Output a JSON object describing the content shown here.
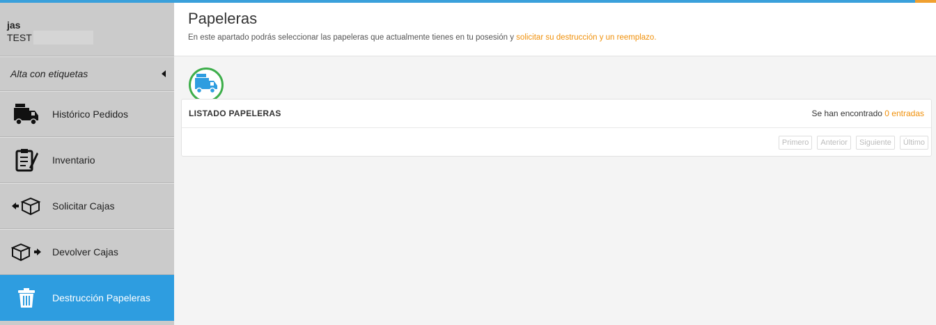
{
  "user": {
    "name": "jas",
    "company": "TEST"
  },
  "sidebar": {
    "alta_label": "Alta con etiquetas",
    "items": [
      {
        "label": "Histórico Pedidos",
        "icon": "delivery-truck-icon"
      },
      {
        "label": "Inventario",
        "icon": "clipboard-pen-icon"
      },
      {
        "label": "Solicitar Cajas",
        "icon": "box-arrow-in-icon"
      },
      {
        "label": "Devolver Cajas",
        "icon": "box-arrow-out-icon"
      },
      {
        "label": "Destrucción Papeleras",
        "icon": "trash-bin-icon",
        "active": true
      }
    ]
  },
  "header": {
    "title": "Papeleras",
    "subtitle_text": "En este apartado podrás seleccionar las papeleras que actualmente tienes en tu posesión y ",
    "subtitle_link": "solicitar su destrucción y un reemplazo."
  },
  "panel": {
    "title": "LISTADO PAPELERAS",
    "count_prefix": "Se han encontrado ",
    "count_value": "0 entradas",
    "pager": {
      "first": "Primero",
      "prev": "Anterior",
      "next": "Siguiente",
      "last": "Último"
    }
  },
  "colors": {
    "accent": "#2e9de0",
    "link": "#f0900a",
    "truck_ring": "#3dae4a"
  }
}
